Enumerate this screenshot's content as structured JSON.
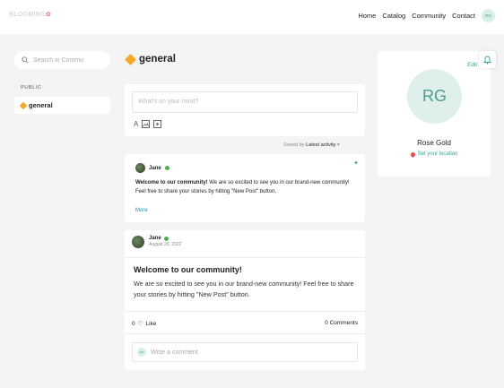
{
  "topbar": {
    "logo": "BLOOMING",
    "nav": [
      "Home",
      "Catalog",
      "Community",
      "Contact"
    ],
    "avatar_initials": "RG"
  },
  "sidebar": {
    "search_placeholder": "Search in Commu",
    "section_heading": "PUBLIC",
    "channels": [
      {
        "label": "general"
      }
    ]
  },
  "channel": {
    "title": "general"
  },
  "composer": {
    "placeholder": "What's on your mind?",
    "tool_text": "A"
  },
  "sort": {
    "prefix": "Sorted by",
    "value": "Latest activity"
  },
  "pinned_post": {
    "author": "Jane",
    "lead": "Welcome to our community!",
    "text": " We are so excited to see you in our brand-new community! Feel free to share your stories by hitting \"New Post\" button.",
    "more": "More"
  },
  "post": {
    "author": "Jane",
    "date": "August 29, 2022",
    "title": "Welcome to our community!",
    "body": "We are so excited to see you in our brand-new community! Feel free to share your stories by hitting \"New Post\" button.",
    "likes": "0",
    "like_label": "Like",
    "comments_count": "0",
    "comments_label": "Comments",
    "comment_placeholder": "Write a comment",
    "commenter_initials": "RG"
  },
  "profile": {
    "edit": "Edit",
    "initials": "RG",
    "name": "Rose Gold",
    "location_link": "Set your location"
  }
}
